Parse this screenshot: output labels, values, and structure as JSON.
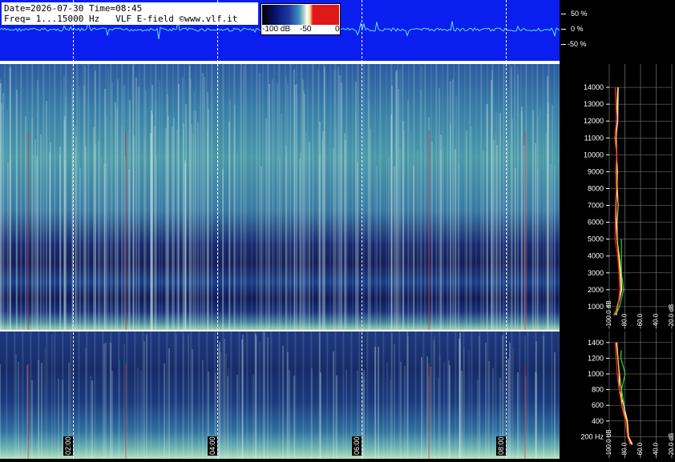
{
  "header": {
    "line1": "Date=2026-07-30 Time=08:45",
    "line2": "Freq= 1...15000 Hz   VLF E-field ©www.vlf.it"
  },
  "color_scale": {
    "labels": [
      "-100 dB",
      "-50",
      "0"
    ]
  },
  "waveform_scale": [
    "50 %",
    "0 %",
    "-50 %"
  ],
  "time_labels": [
    "02:00",
    "04:00",
    "06:00",
    "08:00"
  ],
  "chart_data": [
    {
      "type": "heatmap",
      "title": "",
      "panel": "full-band spectrogram",
      "y_axis_ticks": [
        "1000",
        "2000",
        "3000",
        "4000",
        "5000",
        "6000",
        "7000",
        "8000",
        "9000",
        "10000",
        "11000",
        "12000",
        "13000",
        "14000"
      ],
      "x_axis_ticks": [
        "02:00",
        "04:00",
        "06:00",
        "08:00"
      ],
      "ylim": [
        0,
        15000
      ],
      "units": "Hz"
    },
    {
      "type": "heatmap",
      "title": "",
      "panel": "low-band spectrogram",
      "y_axis_ticks": [
        "200 Hz",
        "400",
        "600",
        "800",
        "1000",
        "1200",
        "1400"
      ],
      "ylim": [
        0,
        1500
      ]
    },
    {
      "type": "line",
      "panel": "average spectrum (full band)",
      "x_axis_ticks": [
        "-100.0 dB",
        "-80.0",
        "-60.0",
        "-40.0",
        "-20.0 dB"
      ],
      "series": [
        {
          "color": "#ffffff",
          "x": [
            -92,
            -88,
            -84,
            -86,
            -88,
            -90,
            -91,
            -90,
            -90,
            -89,
            -90,
            -90,
            -90,
            -90
          ],
          "y": [
            500,
            1000,
            2000,
            3000,
            4000,
            5000,
            6000,
            7000,
            8000,
            9000,
            10000,
            11000,
            12000,
            14000
          ]
        },
        {
          "color": "#ffd21a",
          "x": [
            -93,
            -89,
            -85,
            -85,
            -87,
            -89,
            -90,
            -90,
            -90,
            -89,
            -89,
            -90,
            -90,
            -90
          ],
          "y": [
            500,
            1000,
            2000,
            3000,
            4000,
            5000,
            6000,
            7000,
            8000,
            9000,
            10000,
            11000,
            12000,
            14000
          ]
        },
        {
          "color": "#2fdc3c",
          "x": [
            -91,
            -86,
            -82,
            -83,
            -85,
            -86
          ],
          "y": [
            500,
            1000,
            2000,
            3000,
            4000,
            5000
          ]
        },
        {
          "color": "#ff2222",
          "x": [
            -94,
            -90,
            -86,
            -87,
            -89,
            -91,
            -92,
            -92,
            -91,
            -91,
            -91,
            -92,
            -92,
            -92
          ],
          "y": [
            500,
            1000,
            2000,
            3000,
            4000,
            5000,
            6000,
            7000,
            8000,
            9000,
            10000,
            11000,
            12000,
            14000
          ]
        }
      ]
    },
    {
      "type": "line",
      "panel": "average spectrum (low band)",
      "x_axis_ticks": [
        "-100.0 dB",
        "-80.0",
        "-60.0",
        "-40.0",
        "-20.0 dB"
      ],
      "series": [
        {
          "color": "#ffffff",
          "x": [
            -70,
            -74,
            -78,
            -82,
            -86,
            -88,
            -90
          ],
          "y": [
            100,
            200,
            400,
            600,
            800,
            1000,
            1400
          ]
        },
        {
          "color": "#ffd21a",
          "x": [
            -71,
            -75,
            -79,
            -83,
            -86,
            -88,
            -90
          ],
          "y": [
            100,
            200,
            400,
            600,
            800,
            1000,
            1400
          ]
        },
        {
          "color": "#2fdc3c",
          "x": [
            -80,
            -84,
            -80,
            -82,
            -84,
            -86
          ],
          "y": [
            600,
            800,
            1000,
            1100,
            1200,
            1300
          ]
        },
        {
          "color": "#ff2222",
          "x": [
            -72,
            -76,
            -80,
            -84,
            -87,
            -89,
            -91
          ],
          "y": [
            100,
            200,
            400,
            600,
            800,
            1000,
            1400
          ]
        }
      ]
    }
  ]
}
